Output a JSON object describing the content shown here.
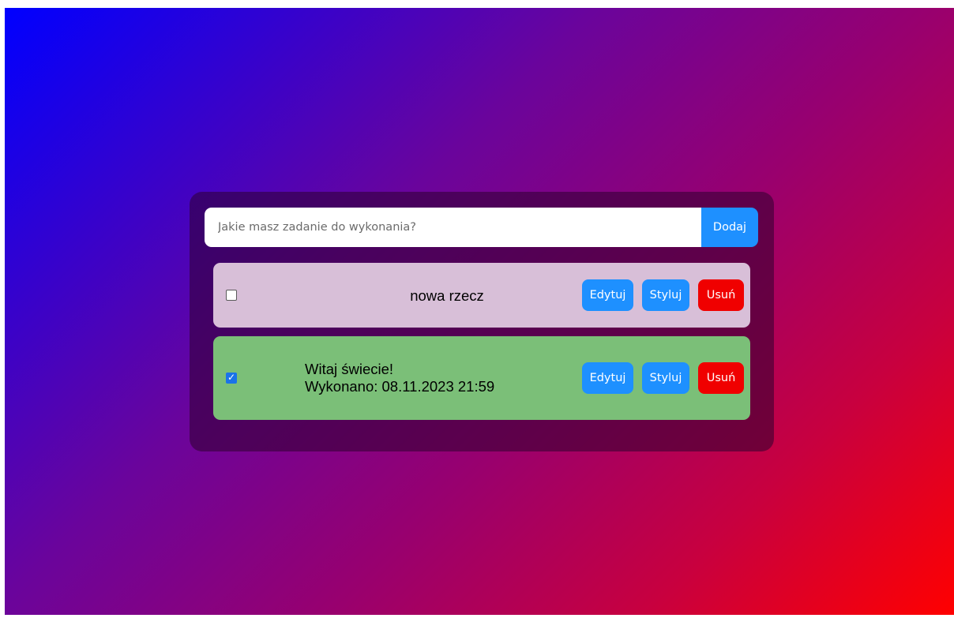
{
  "input": {
    "placeholder": "Jakie masz zadanie do wykonania?",
    "add_label": "Dodaj"
  },
  "tasks": [
    {
      "text": "nowa rzecz",
      "done": false,
      "background": "#d8bfd8",
      "edit_label": "Edytuj",
      "style_label": "Styluj",
      "delete_label": "Usuń"
    },
    {
      "text": "Witaj świecie!",
      "completed_text": "Wykonano: 08.11.2023 21:59",
      "done": true,
      "background": "#7bbf78",
      "edit_label": "Edytuj",
      "style_label": "Styluj",
      "delete_label": "Usuń"
    }
  ],
  "colors": {
    "primary_button": "#1e90ff",
    "delete_button": "#f00000",
    "gradient_start": "#0000ff",
    "gradient_end": "#ff0000"
  }
}
